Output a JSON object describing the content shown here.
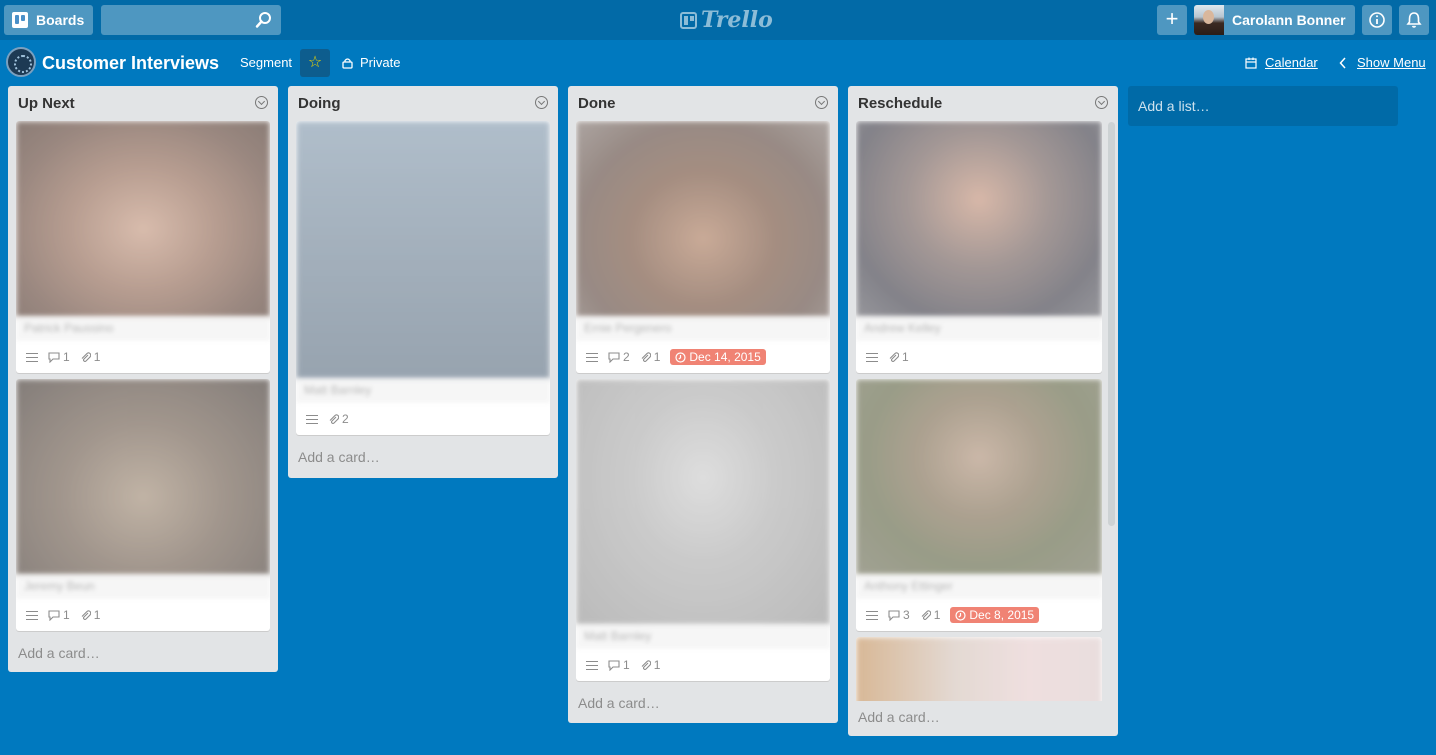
{
  "header": {
    "boards_label": "Boards",
    "search_placeholder": "",
    "logo_text": "Trello",
    "user_name": "Carolann Bonner"
  },
  "board": {
    "title": "Customer Interviews",
    "team": "Segment",
    "visibility": "Private",
    "calendar_label": "Calendar",
    "show_menu_label": "Show Menu",
    "starred_color": "#f2d600"
  },
  "lists": [
    {
      "title": "Up Next",
      "add_card": "Add a card…",
      "cards": [
        {
          "title": "Patrick Paussino",
          "comments": "1",
          "attachments": "1",
          "cover": "#8a6a55"
        },
        {
          "title": "Jeremy Beun",
          "comments": "1",
          "attachments": "1",
          "cover": "#6b5e52"
        }
      ]
    },
    {
      "title": "Doing",
      "add_card": "Add a card…",
      "cards": [
        {
          "title": "Matt Barnley",
          "attachments": "2",
          "cover": "#7c93a8"
        }
      ]
    },
    {
      "title": "Done",
      "add_card": "Add a card…",
      "cards": [
        {
          "title": "Ernie Pergenero",
          "comments": "2",
          "attachments": "1",
          "due": "Dec 14, 2015",
          "cover": "#8d6d5c"
        },
        {
          "title": "Matt Barnley",
          "comments": "1",
          "attachments": "1",
          "cover": "#a9a9a9"
        }
      ]
    },
    {
      "title": "Reschedule",
      "add_card": "Add a card…",
      "cards": [
        {
          "title": "Andrew Kelley",
          "attachments": "1",
          "cover": "#6b6e78"
        },
        {
          "title": "Anthony Ettinger",
          "comments": "3",
          "attachments": "1",
          "due": "Dec 8, 2015",
          "cover": "#7a7a5a"
        }
      ]
    }
  ],
  "add_list": "Add a list…",
  "colors": {
    "board_bg": "#0079bf",
    "header_bg": "#026aa7",
    "due_badge": "#eb5a46"
  }
}
